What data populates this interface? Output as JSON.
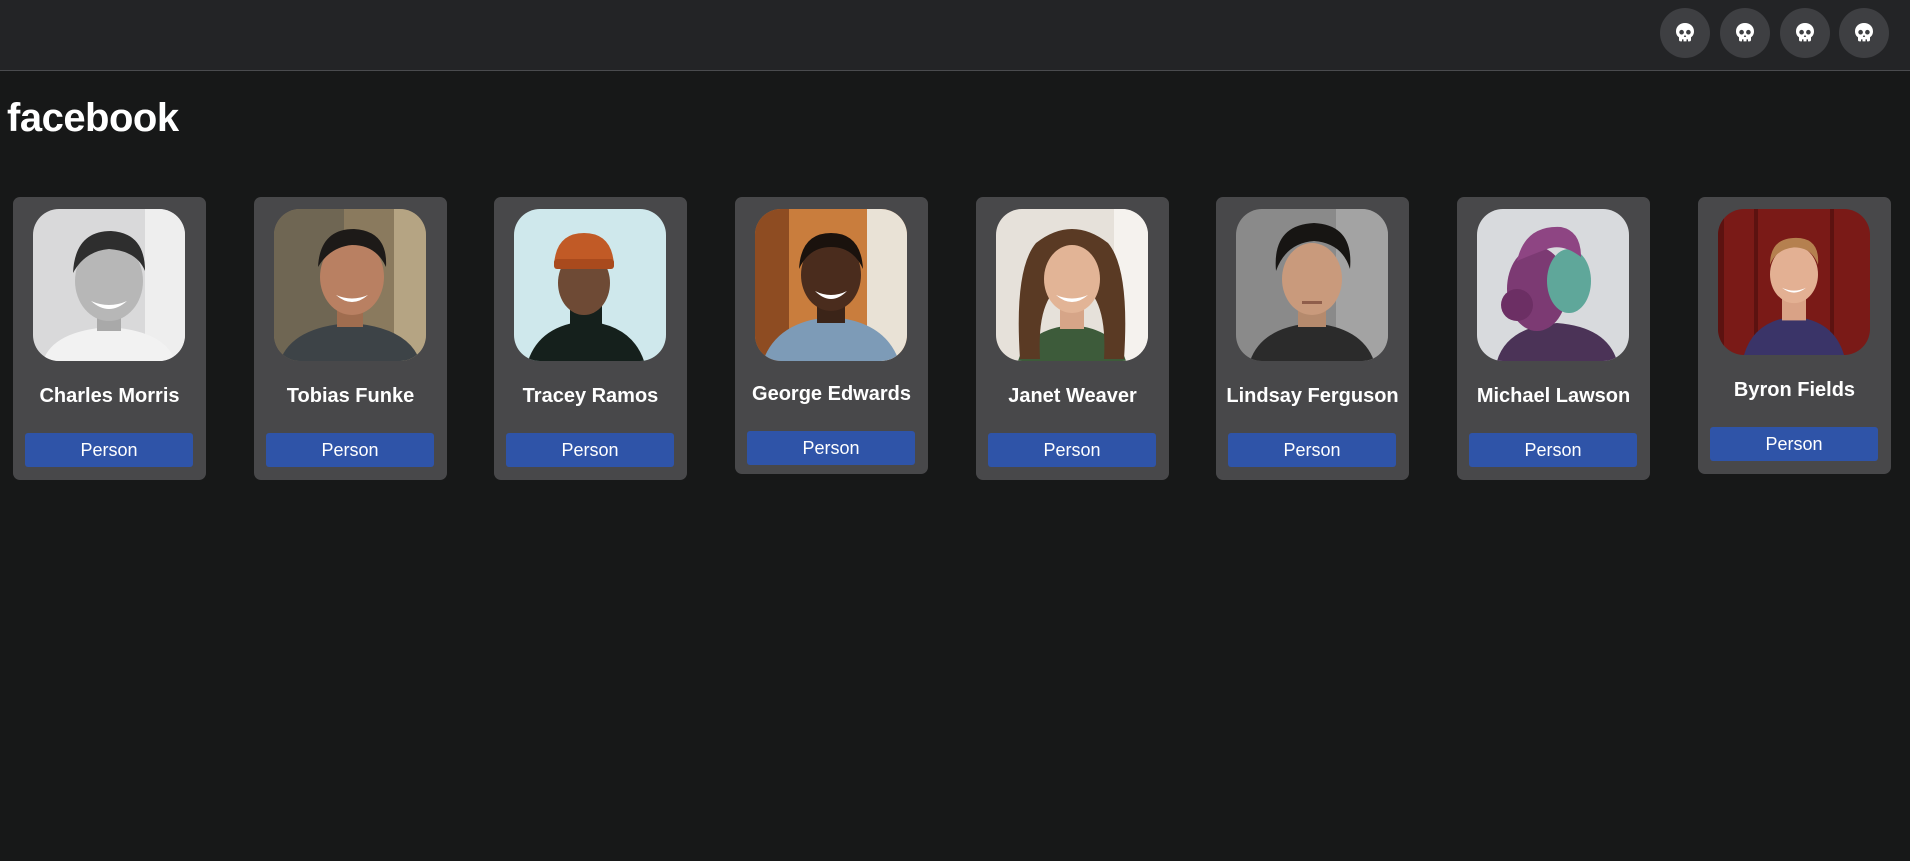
{
  "header": {
    "icons": [
      {
        "name": "skull-icon"
      },
      {
        "name": "skull-icon"
      },
      {
        "name": "skull-icon"
      },
      {
        "name": "skull-icon"
      }
    ]
  },
  "app_title": "facebook",
  "people": [
    {
      "name": "Charles Morris",
      "type": "Person"
    },
    {
      "name": "Tobias Funke",
      "type": "Person"
    },
    {
      "name": "Tracey Ramos",
      "type": "Person"
    },
    {
      "name": "George Edwards",
      "type": "Person"
    },
    {
      "name": "Janet Weaver",
      "type": "Person"
    },
    {
      "name": "Lindsay Ferguson",
      "type": "Person"
    },
    {
      "name": "Michael Lawson",
      "type": "Person"
    },
    {
      "name": "Byron Fields",
      "type": "Person"
    }
  ],
  "colors": {
    "background": "#171818",
    "topbar": "#232426",
    "card": "#48484a",
    "button": "#2f54a8"
  }
}
